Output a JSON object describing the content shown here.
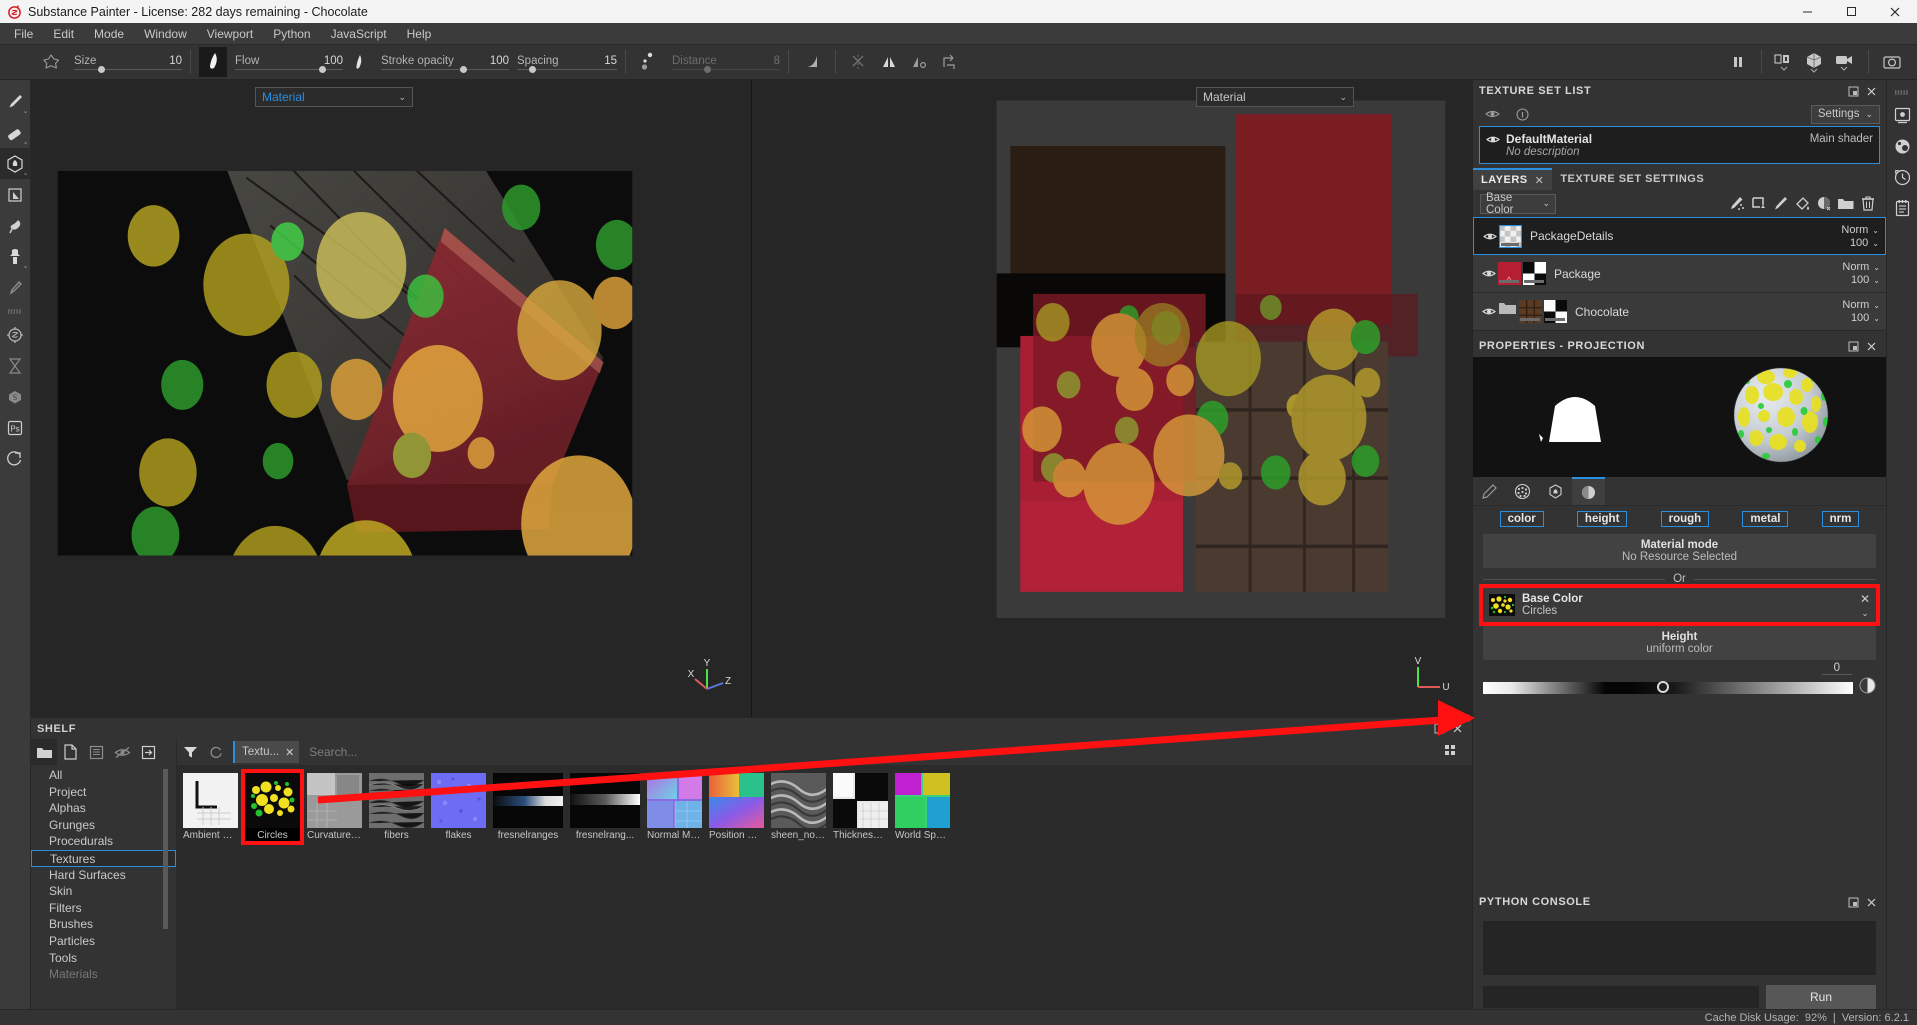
{
  "window": {
    "title": "Substance Painter - License: 282 days remaining - Chocolate",
    "logo_icon": "substance-logo-icon",
    "minimize_label": "—",
    "maximize_label": "☐",
    "close_label": "✕"
  },
  "menubar": {
    "items": [
      "File",
      "Edit",
      "Mode",
      "Window",
      "Viewport",
      "Python",
      "JavaScript",
      "Help"
    ]
  },
  "toolbar": {
    "brush_shape_icon": "brush-shape-icon",
    "params": [
      {
        "label": "Size",
        "value": "10",
        "fill": 0.22,
        "disabled": false
      },
      {
        "label": "Flow",
        "value": "100",
        "fill": 0.78,
        "disabled": false
      },
      {
        "label": "Stroke opacity",
        "value": "100",
        "fill": 0.62,
        "disabled": false
      },
      {
        "label": "Spacing",
        "value": "15",
        "fill": 0.12,
        "disabled": false
      },
      {
        "label": "Distance",
        "value": "8",
        "fill": 0.3,
        "disabled": true
      }
    ],
    "icons": [
      {
        "name": "falloff-icon"
      },
      {
        "name": "symmetry-disabled-icon"
      },
      {
        "name": "mirror-icon"
      },
      {
        "name": "tilt-icon"
      },
      {
        "name": "transform-icon"
      }
    ],
    "right_icons": [
      {
        "name": "pause-engine-icon"
      },
      {
        "name": "display-channel-icon"
      },
      {
        "name": "shader-view-icon"
      },
      {
        "name": "camera-icon"
      },
      {
        "name": "screenshot-icon"
      }
    ]
  },
  "left_rail": {
    "items": [
      {
        "name": "paint-tool-icon",
        "caret": true,
        "active": false
      },
      {
        "name": "eraser-tool-icon",
        "caret": true,
        "active": false
      },
      {
        "name": "projection-tool-icon",
        "caret": true,
        "active": true
      },
      {
        "name": "polygon-fill-icon",
        "caret": false,
        "active": false
      },
      {
        "name": "smudge-tool-icon",
        "caret": false,
        "active": false
      },
      {
        "name": "clone-tool-icon",
        "caret": true,
        "active": false
      },
      {
        "name": "eyedropper-icon",
        "caret": false,
        "active": false
      },
      {
        "name": "separator",
        "caret": false,
        "active": false
      },
      {
        "name": "bake-icon",
        "caret": false,
        "active": false
      },
      {
        "name": "hourglass-icon",
        "caret": false,
        "active": false
      },
      {
        "name": "substance-source-icon",
        "caret": false,
        "active": false
      },
      {
        "name": "photoshop-icon",
        "caret": false,
        "active": false
      },
      {
        "name": "iray-render-icon",
        "caret": false,
        "active": false
      }
    ]
  },
  "viewport_3d": {
    "name": "3d-viewport",
    "channel_selector": "Material",
    "chevron_icon": "chevron-down-icon",
    "axis": {
      "x": "X",
      "y": "Y",
      "z": "Z"
    }
  },
  "viewport_2d": {
    "name": "2d-uv-viewport",
    "channel_selector": "Material",
    "chevron_icon": "chevron-down-icon",
    "axis": {
      "u": "U",
      "v": "V"
    }
  },
  "shelf": {
    "title": "SHELF",
    "maximize_icon": "maximize-icon",
    "close_icon": "close-icon",
    "tools": [
      {
        "name": "folder-icon",
        "active": true
      },
      {
        "name": "new-file-icon",
        "active": false
      },
      {
        "name": "save-icon",
        "active": false
      },
      {
        "name": "hide-icon",
        "active": false
      },
      {
        "name": "import-icon",
        "active": false
      }
    ],
    "filter_icon": "filter-icon",
    "refresh_icon": "refresh-icon",
    "tag": {
      "label": "Textu...",
      "close_icon": "close-icon"
    },
    "search_placeholder": "Search...",
    "grid_view_icon": "grid-view-icon",
    "categories": [
      {
        "label": "All",
        "selected": false
      },
      {
        "label": "Project",
        "selected": false
      },
      {
        "label": "Alphas",
        "selected": false
      },
      {
        "label": "Grunges",
        "selected": false
      },
      {
        "label": "Procedurals",
        "selected": false
      },
      {
        "label": "Textures",
        "selected": true
      },
      {
        "label": "Hard Surfaces",
        "selected": false
      },
      {
        "label": "Skin",
        "selected": false
      },
      {
        "label": "Filters",
        "selected": false
      },
      {
        "label": "Brushes",
        "selected": false
      },
      {
        "label": "Particles",
        "selected": false
      },
      {
        "label": "Tools",
        "selected": false
      },
      {
        "label": "Materials",
        "selected": false
      }
    ],
    "items": [
      {
        "label": "Ambient O...",
        "kind": "ambient-occlusion",
        "selected": false
      },
      {
        "label": "Circles",
        "kind": "circles",
        "selected": true
      },
      {
        "label": "Curvature ...",
        "kind": "curvature",
        "selected": false
      },
      {
        "label": "fibers",
        "kind": "fibers",
        "selected": false
      },
      {
        "label": "flakes",
        "kind": "flakes",
        "selected": false
      },
      {
        "label": "fresnelranges",
        "kind": "fresnelranges",
        "selected": false
      },
      {
        "label": "fresnelrang...",
        "kind": "fresnelranges2",
        "selected": false
      },
      {
        "label": "Normal Ma...",
        "kind": "normalmap",
        "selected": false
      },
      {
        "label": "Position De...",
        "kind": "position",
        "selected": false
      },
      {
        "label": "sheen_noise",
        "kind": "sheen",
        "selected": false
      },
      {
        "label": "Thickness ...",
        "kind": "thickness",
        "selected": false
      },
      {
        "label": "World Spac...",
        "kind": "worldspace",
        "selected": false
      }
    ]
  },
  "texture_set_list": {
    "title": "TEXTURE SET LIST",
    "maximize_icon": "maximize-icon",
    "close_icon": "close-icon",
    "eye_icon": "eye-toggle-icon",
    "info_icon": "info-icon",
    "settings_label": "Settings",
    "settings_chevron": "chevron-down-icon",
    "material": {
      "eye_icon": "eye-icon",
      "name": "DefaultMaterial",
      "shader": "Main shader",
      "description": "No description"
    }
  },
  "layers_panel": {
    "tabs": [
      {
        "label": "LAYERS",
        "active": true,
        "close_icon": "close-icon"
      },
      {
        "label": "TEXTURE SET SETTINGS",
        "active": false,
        "close_icon": null
      }
    ],
    "channel": "Base Color",
    "channel_chevron": "chevron-down-icon",
    "tools": [
      {
        "name": "add-effect-icon"
      },
      {
        "name": "add-fill-layer-icon"
      },
      {
        "name": "add-paint-layer-icon"
      },
      {
        "name": "add-fill-icon"
      },
      {
        "name": "add-mask-icon"
      },
      {
        "name": "add-folder-icon"
      },
      {
        "name": "delete-layer-icon"
      }
    ],
    "layers": [
      {
        "name": "PackageDetails",
        "blend": "Norm",
        "opacity": "100",
        "selected": true,
        "thumb": "checker",
        "has_mask": false,
        "is_folder": false
      },
      {
        "name": "Package",
        "blend": "Norm",
        "opacity": "100",
        "selected": false,
        "thumb": "red",
        "has_mask": true,
        "is_folder": false
      },
      {
        "name": "Chocolate",
        "blend": "Norm",
        "opacity": "100",
        "selected": false,
        "thumb": "chocolate",
        "has_mask": true,
        "is_folder": true
      }
    ]
  },
  "properties_panel": {
    "title": "PROPERTIES - PROJECTION",
    "maximize_icon": "maximize-icon",
    "close_icon": "close-icon",
    "preview_alpha_name": "alpha-preview",
    "preview_sphere_name": "material-sphere-preview",
    "tabs": [
      {
        "name": "brush-properties-icon",
        "active": false
      },
      {
        "name": "alpha-properties-icon",
        "active": false
      },
      {
        "name": "stencil-properties-icon",
        "active": false
      },
      {
        "name": "material-properties-icon",
        "active": true
      }
    ],
    "channels": [
      {
        "label": "color"
      },
      {
        "label": "height"
      },
      {
        "label": "rough"
      },
      {
        "label": "metal"
      },
      {
        "label": "nrm"
      }
    ],
    "material_mode": {
      "title": "Material mode",
      "subtitle": "No Resource Selected"
    },
    "or_label": "Or",
    "base_color_slot": {
      "title": "Base Color",
      "value": "Circles",
      "close_icon": "close-icon",
      "chevron_icon": "chevron-down-icon",
      "thumb": "circles",
      "highlighted": true
    },
    "height_slot": {
      "title": "Height",
      "subtitle": "uniform color"
    },
    "height_value": "0",
    "height_slider_pos": 0.47,
    "color_wheel_icon": "color-wheel-icon"
  },
  "python_console": {
    "title": "PYTHON CONSOLE",
    "maximize_icon": "maximize-icon",
    "close_icon": "close-icon",
    "output": "",
    "input_value": "",
    "run_label": "Run"
  },
  "right_rail": {
    "items": [
      {
        "name": "drag-handle-icon"
      },
      {
        "name": "settings-gear-icon"
      },
      {
        "name": "display-settings-icon"
      },
      {
        "name": "history-icon"
      },
      {
        "name": "log-icon"
      }
    ]
  },
  "statusbar": {
    "cache_label": "Cache Disk Usage:",
    "cache_value": "92%",
    "separator": "|",
    "version": "Version: 6.2.1"
  },
  "annotation": {
    "arrow_color": "#ff1111",
    "from_name": "shelf-circles-thumbnail",
    "to_name": "base-color-resource-slot"
  },
  "colors": {
    "accent": "#2b8fe0",
    "highlight": "#ff1111",
    "panel_bg": "#333333",
    "dark_bg": "#1e1e1e"
  }
}
